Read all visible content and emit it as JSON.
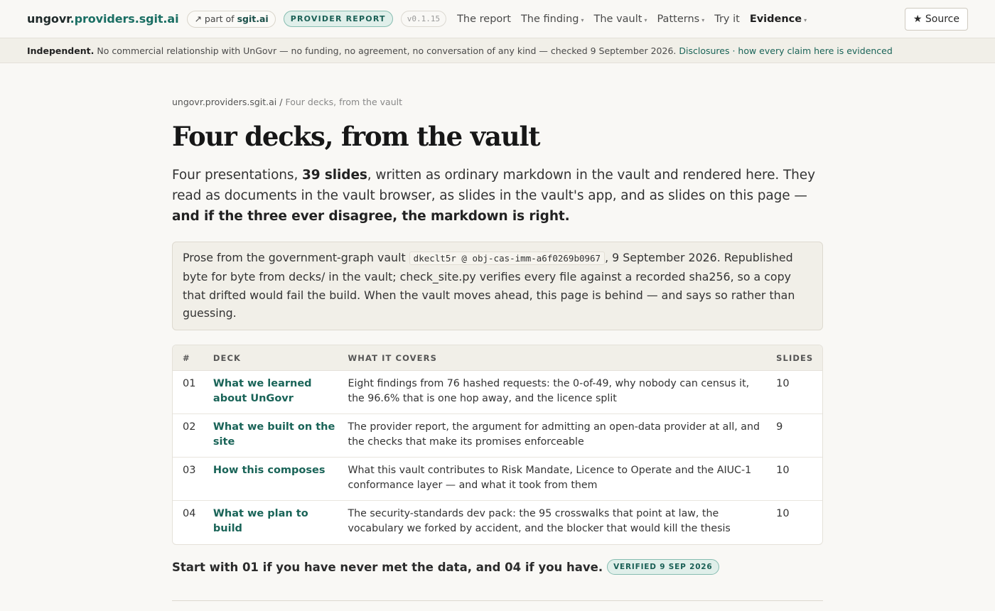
{
  "header": {
    "brand_plain": "ungovr",
    "brand_accent": ".providers.sgit.ai",
    "part_of_prefix": "↗ part of",
    "part_of_site": "sgit.ai",
    "report_badge": "PROVIDER REPORT",
    "version": "v0.1.15",
    "nav": [
      {
        "label": "The report",
        "has_menu": false
      },
      {
        "label": "The finding",
        "has_menu": true
      },
      {
        "label": "The vault",
        "has_menu": true
      },
      {
        "label": "Patterns",
        "has_menu": true
      },
      {
        "label": "Try it",
        "has_menu": false
      },
      {
        "label": "Evidence",
        "has_menu": true,
        "active": true
      }
    ],
    "caret": "▾",
    "source_button": "★ Source"
  },
  "notice": {
    "strong": "Independent.",
    "text": "No commercial relationship with UnGovr — no funding, no agreement, no conversation of any kind — checked 9 September 2026.",
    "link": "Disclosures · how every claim here is evidenced"
  },
  "breadcrumb": {
    "root": "ungovr.providers.sgit.ai",
    "separator": " / ",
    "current": "Four decks, from the vault"
  },
  "title": "Four decks, from the vault",
  "lead": {
    "part1": "Four presentations, ",
    "bold1": "39 slides",
    "part2": ", written as ordinary markdown in the vault and rendered here. They read as documents in the vault browser, as slides in the vault's app, and as slides on this page — ",
    "bold2": "and if the three ever disagree, the markdown is right."
  },
  "provenance": {
    "part1": "Prose from the government-graph vault ",
    "code": "dkeclt5r @ obj-cas-imm-a6f0269b0967",
    "part2": ", 9 September 2026. Republished byte for byte from decks/ in the vault; check_site.py verifies every file against a recorded sha256, so a copy that drifted would fail the build. When the vault moves ahead, this page is behind — and says so rather than guessing."
  },
  "table": {
    "headers": {
      "num": "#",
      "deck": "DECK",
      "what": "WHAT IT COVERS",
      "slides": "SLIDES"
    },
    "rows": [
      {
        "num": "01",
        "deck": "What we learned about UnGovr",
        "what": "Eight findings from 76 hashed requests: the 0-of-49, why nobody can census it, the 96.6% that is one hop away, and the licence split",
        "slides": "10"
      },
      {
        "num": "02",
        "deck": "What we built on the site",
        "what": "The provider report, the argument for admitting an open-data provider at all, and the checks that make its promises enforceable",
        "slides": "9"
      },
      {
        "num": "03",
        "deck": "How this composes",
        "what": "What this vault contributes to Risk Mandate, Licence to Operate and the AIUC-1 conformance layer — and what it took from them",
        "slides": "10"
      },
      {
        "num": "04",
        "deck": "What we plan to build",
        "what": "The security-standards dev pack: the 95 crosswalks that point at law, the vocabulary we forked by accident, and the blocker that would kill the thesis",
        "slides": "10"
      }
    ]
  },
  "footer_line": {
    "text": "Start with 01 if you have never met the data, and 04 if you have.",
    "badge": "VERIFIED 9 SEP 2026"
  },
  "colors": {
    "accent": "#1a6e63",
    "link": "#1a6458",
    "page_bg": "#f9f8f5",
    "panel_bg": "#f1efe8"
  }
}
